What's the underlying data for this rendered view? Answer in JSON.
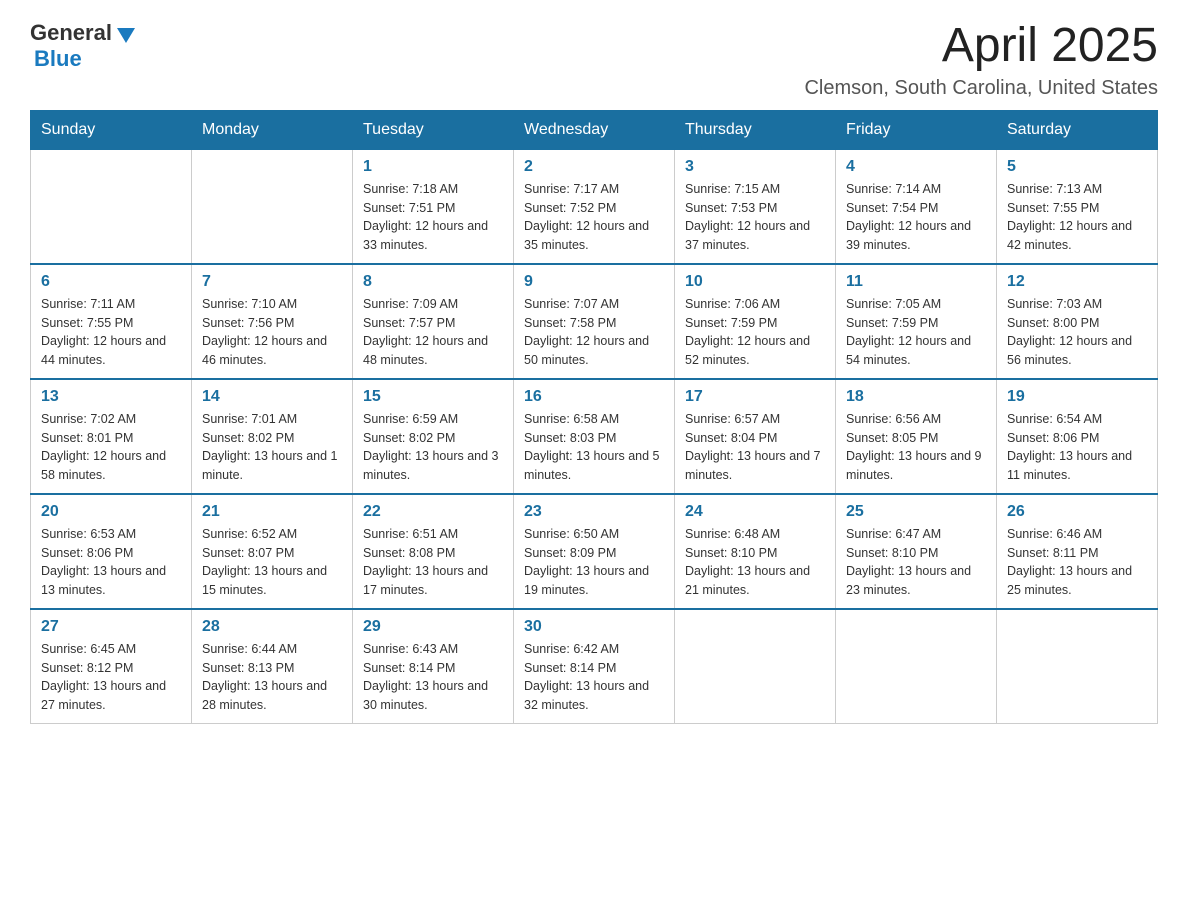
{
  "logo": {
    "general": "General",
    "blue": "Blue"
  },
  "title": {
    "month_year": "April 2025",
    "location": "Clemson, South Carolina, United States"
  },
  "headers": [
    "Sunday",
    "Monday",
    "Tuesday",
    "Wednesday",
    "Thursday",
    "Friday",
    "Saturday"
  ],
  "weeks": [
    [
      {
        "day": "",
        "sunrise": "",
        "sunset": "",
        "daylight": ""
      },
      {
        "day": "",
        "sunrise": "",
        "sunset": "",
        "daylight": ""
      },
      {
        "day": "1",
        "sunrise": "Sunrise: 7:18 AM",
        "sunset": "Sunset: 7:51 PM",
        "daylight": "Daylight: 12 hours and 33 minutes."
      },
      {
        "day": "2",
        "sunrise": "Sunrise: 7:17 AM",
        "sunset": "Sunset: 7:52 PM",
        "daylight": "Daylight: 12 hours and 35 minutes."
      },
      {
        "day": "3",
        "sunrise": "Sunrise: 7:15 AM",
        "sunset": "Sunset: 7:53 PM",
        "daylight": "Daylight: 12 hours and 37 minutes."
      },
      {
        "day": "4",
        "sunrise": "Sunrise: 7:14 AM",
        "sunset": "Sunset: 7:54 PM",
        "daylight": "Daylight: 12 hours and 39 minutes."
      },
      {
        "day": "5",
        "sunrise": "Sunrise: 7:13 AM",
        "sunset": "Sunset: 7:55 PM",
        "daylight": "Daylight: 12 hours and 42 minutes."
      }
    ],
    [
      {
        "day": "6",
        "sunrise": "Sunrise: 7:11 AM",
        "sunset": "Sunset: 7:55 PM",
        "daylight": "Daylight: 12 hours and 44 minutes."
      },
      {
        "day": "7",
        "sunrise": "Sunrise: 7:10 AM",
        "sunset": "Sunset: 7:56 PM",
        "daylight": "Daylight: 12 hours and 46 minutes."
      },
      {
        "day": "8",
        "sunrise": "Sunrise: 7:09 AM",
        "sunset": "Sunset: 7:57 PM",
        "daylight": "Daylight: 12 hours and 48 minutes."
      },
      {
        "day": "9",
        "sunrise": "Sunrise: 7:07 AM",
        "sunset": "Sunset: 7:58 PM",
        "daylight": "Daylight: 12 hours and 50 minutes."
      },
      {
        "day": "10",
        "sunrise": "Sunrise: 7:06 AM",
        "sunset": "Sunset: 7:59 PM",
        "daylight": "Daylight: 12 hours and 52 minutes."
      },
      {
        "day": "11",
        "sunrise": "Sunrise: 7:05 AM",
        "sunset": "Sunset: 7:59 PM",
        "daylight": "Daylight: 12 hours and 54 minutes."
      },
      {
        "day": "12",
        "sunrise": "Sunrise: 7:03 AM",
        "sunset": "Sunset: 8:00 PM",
        "daylight": "Daylight: 12 hours and 56 minutes."
      }
    ],
    [
      {
        "day": "13",
        "sunrise": "Sunrise: 7:02 AM",
        "sunset": "Sunset: 8:01 PM",
        "daylight": "Daylight: 12 hours and 58 minutes."
      },
      {
        "day": "14",
        "sunrise": "Sunrise: 7:01 AM",
        "sunset": "Sunset: 8:02 PM",
        "daylight": "Daylight: 13 hours and 1 minute."
      },
      {
        "day": "15",
        "sunrise": "Sunrise: 6:59 AM",
        "sunset": "Sunset: 8:02 PM",
        "daylight": "Daylight: 13 hours and 3 minutes."
      },
      {
        "day": "16",
        "sunrise": "Sunrise: 6:58 AM",
        "sunset": "Sunset: 8:03 PM",
        "daylight": "Daylight: 13 hours and 5 minutes."
      },
      {
        "day": "17",
        "sunrise": "Sunrise: 6:57 AM",
        "sunset": "Sunset: 8:04 PM",
        "daylight": "Daylight: 13 hours and 7 minutes."
      },
      {
        "day": "18",
        "sunrise": "Sunrise: 6:56 AM",
        "sunset": "Sunset: 8:05 PM",
        "daylight": "Daylight: 13 hours and 9 minutes."
      },
      {
        "day": "19",
        "sunrise": "Sunrise: 6:54 AM",
        "sunset": "Sunset: 8:06 PM",
        "daylight": "Daylight: 13 hours and 11 minutes."
      }
    ],
    [
      {
        "day": "20",
        "sunrise": "Sunrise: 6:53 AM",
        "sunset": "Sunset: 8:06 PM",
        "daylight": "Daylight: 13 hours and 13 minutes."
      },
      {
        "day": "21",
        "sunrise": "Sunrise: 6:52 AM",
        "sunset": "Sunset: 8:07 PM",
        "daylight": "Daylight: 13 hours and 15 minutes."
      },
      {
        "day": "22",
        "sunrise": "Sunrise: 6:51 AM",
        "sunset": "Sunset: 8:08 PM",
        "daylight": "Daylight: 13 hours and 17 minutes."
      },
      {
        "day": "23",
        "sunrise": "Sunrise: 6:50 AM",
        "sunset": "Sunset: 8:09 PM",
        "daylight": "Daylight: 13 hours and 19 minutes."
      },
      {
        "day": "24",
        "sunrise": "Sunrise: 6:48 AM",
        "sunset": "Sunset: 8:10 PM",
        "daylight": "Daylight: 13 hours and 21 minutes."
      },
      {
        "day": "25",
        "sunrise": "Sunrise: 6:47 AM",
        "sunset": "Sunset: 8:10 PM",
        "daylight": "Daylight: 13 hours and 23 minutes."
      },
      {
        "day": "26",
        "sunrise": "Sunrise: 6:46 AM",
        "sunset": "Sunset: 8:11 PM",
        "daylight": "Daylight: 13 hours and 25 minutes."
      }
    ],
    [
      {
        "day": "27",
        "sunrise": "Sunrise: 6:45 AM",
        "sunset": "Sunset: 8:12 PM",
        "daylight": "Daylight: 13 hours and 27 minutes."
      },
      {
        "day": "28",
        "sunrise": "Sunrise: 6:44 AM",
        "sunset": "Sunset: 8:13 PM",
        "daylight": "Daylight: 13 hours and 28 minutes."
      },
      {
        "day": "29",
        "sunrise": "Sunrise: 6:43 AM",
        "sunset": "Sunset: 8:14 PM",
        "daylight": "Daylight: 13 hours and 30 minutes."
      },
      {
        "day": "30",
        "sunrise": "Sunrise: 6:42 AM",
        "sunset": "Sunset: 8:14 PM",
        "daylight": "Daylight: 13 hours and 32 minutes."
      },
      {
        "day": "",
        "sunrise": "",
        "sunset": "",
        "daylight": ""
      },
      {
        "day": "",
        "sunrise": "",
        "sunset": "",
        "daylight": ""
      },
      {
        "day": "",
        "sunrise": "",
        "sunset": "",
        "daylight": ""
      }
    ]
  ]
}
